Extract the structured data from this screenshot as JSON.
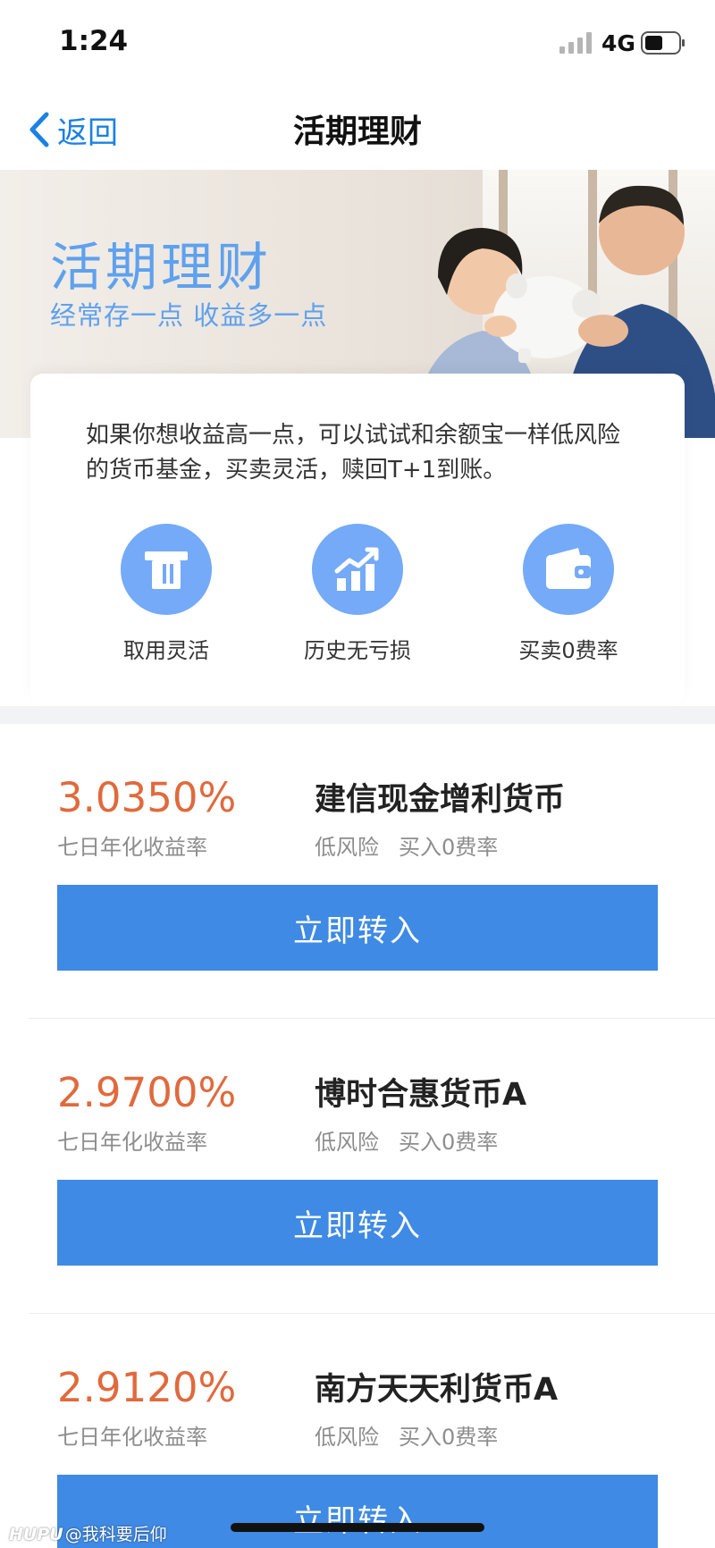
{
  "status_bar": {
    "time": "1:24",
    "network": "4G"
  },
  "nav": {
    "back_label": "返回",
    "title": "活期理财"
  },
  "banner": {
    "title": "活期理财",
    "subtitle": "经常存一点 收益多一点"
  },
  "intro": {
    "text": "如果你想收益高一点，可以试试和余额宝一样低风险的货币基金，买卖灵活，赎回T+1到账。",
    "features": [
      {
        "label": "取用灵活",
        "icon": "card-icon"
      },
      {
        "label": "历史无亏损",
        "icon": "chart-up-icon"
      },
      {
        "label": "买卖0费率",
        "icon": "wallet-icon"
      }
    ]
  },
  "products": [
    {
      "rate": "3.0350%",
      "rate_label": "七日年化收益率",
      "name": "建信现金增利货币",
      "risk": "低风险",
      "fee": "买入0费率",
      "button": "立即转入"
    },
    {
      "rate": "2.9700%",
      "rate_label": "七日年化收益率",
      "name": "博时合惠货币A",
      "risk": "低风险",
      "fee": "买入0费率",
      "button": "立即转入"
    },
    {
      "rate": "2.9120%",
      "rate_label": "七日年化收益率",
      "name": "南方天天利货币A",
      "risk": "低风险",
      "fee": "买入0费率",
      "button": "立即转入"
    }
  ],
  "watermark": {
    "brand": "HUPU",
    "text": "@我科要后仰"
  },
  "colors": {
    "accent_blue": "#3f8ae4",
    "rate_orange": "#e06a3d",
    "icon_blue": "#74aaf7"
  }
}
